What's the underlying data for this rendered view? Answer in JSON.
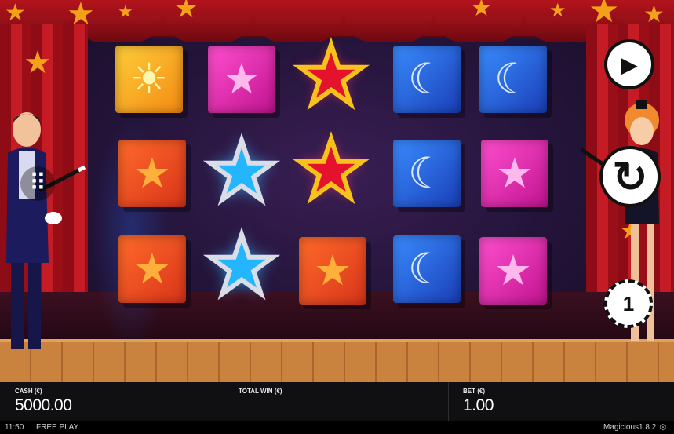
{
  "reels": {
    "rows": [
      [
        "sun-box",
        "pink-star-box",
        "red-star",
        "moon-box",
        "moon-box"
      ],
      [
        "orange-star-box",
        "blue-star",
        "red-star",
        "moon-box",
        "pink-star-box"
      ],
      [
        "orange-star-box",
        "blue-star",
        "orange-star-box",
        "moon-box",
        "pink-star-box"
      ]
    ]
  },
  "icons": {
    "sun": "☀",
    "star": "★",
    "moon": "☾",
    "menu": "⠿",
    "play": "▶",
    "spin": "↻",
    "coin": "1"
  },
  "buttons": {
    "autoplay_icon": "play-icon",
    "spin_icon": "spin-arrows-icon",
    "bet_icon": "coin-icon",
    "menu_icon": "dots-grid-icon"
  },
  "footer": {
    "cash_label": "CASH (€)",
    "cash_value": "5000.00",
    "total_win_label": "TOTAL WIN (€)",
    "total_win_value": "",
    "bet_label": "BET (€)",
    "bet_value": "1.00"
  },
  "status": {
    "time": "11:50",
    "mode": "FREE PLAY",
    "game_name": "Magicious",
    "version": "1.8.2",
    "settings_icon": "gear-icon"
  },
  "colors": {
    "red_curtain": "#c41b24",
    "gold_star": "#f8c21c",
    "blue_star": "#23b6ff",
    "pink_box": "#ff4fcf",
    "blue_box": "#3a8cff",
    "orange_box": "#ff6b2a",
    "yellow_box": "#ffce3a"
  }
}
